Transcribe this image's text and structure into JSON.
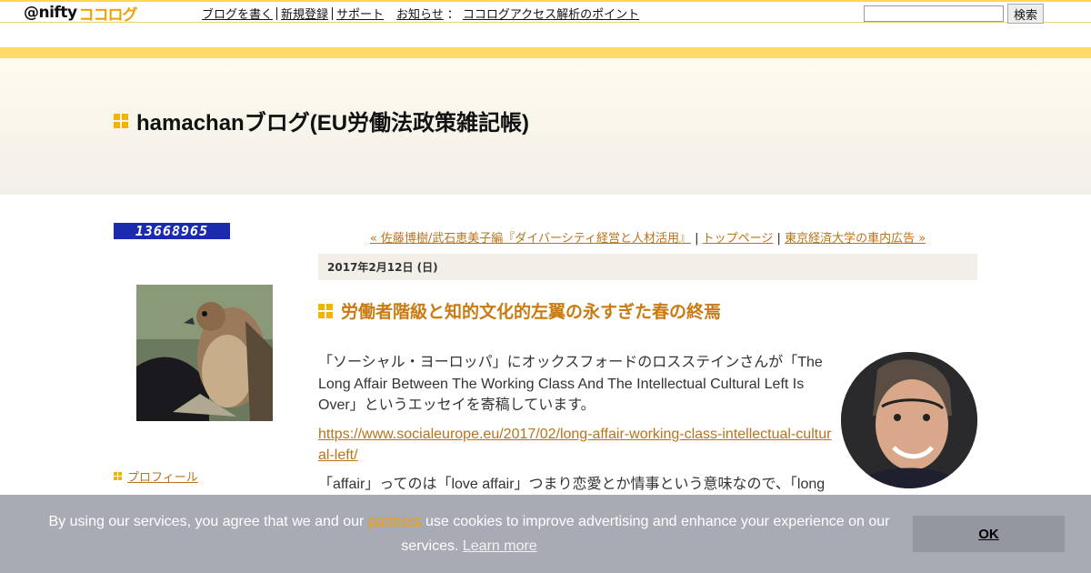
{
  "topbar": {
    "logo_at": "@nifty",
    "logo_coco": "ココログ",
    "nav": {
      "write": "ブログを書く",
      "register": "新規登録",
      "support": "サポート",
      "news": "お知らせ",
      "colon": "：",
      "access": "ココログアクセス解析のポイント"
    },
    "search_value": "",
    "search_button": "検索"
  },
  "header": {
    "blog_title": "hamachanブログ(EU労働法政策雑記帳)"
  },
  "sidebar": {
    "counter": "13668965",
    "profile_link": "プロフィール"
  },
  "main": {
    "pager": {
      "prev": "« 佐藤博樹/武石恵美子編『ダイバーシティ経営と人材活用』",
      "sep1": " | ",
      "top": "トップページ",
      "sep2": " | ",
      "next": "東京経済大学の車内広告 »"
    },
    "date": "2017年2月12日 (日)",
    "entry_title": "労働者階級と知的文化的左翼の永すぎた春の終焉",
    "paragraphs": {
      "p1": "「ソーシャル・ヨーロッパ」にオックスフォードのロスステインさんが「The Long Affair Between The Working Class And The Intellectual Cultural Left Is Over」というエッセイを寄稿しています。",
      "link": "https://www.socialeurope.eu/2017/02/long-affair-working-class-intellectual-cultural-left/",
      "p3": "「affair」ってのは「love affair」つまり恋愛とか情事という意味なので、「long"
    }
  },
  "cookie": {
    "text_before": "By using our services, you agree that we and our ",
    "partners": "partners",
    "text_after": " use cookies to improve advertising and enhance your experience on our services. ",
    "learn_more": "Learn more",
    "ok": "OK"
  },
  "colors": {
    "accent_yellow": "#ffd966",
    "link_orange": "#b8741a",
    "title_orange": "#c97a10",
    "counter_blue": "#1a2bb0",
    "cookie_bg": "#a8abb3"
  }
}
